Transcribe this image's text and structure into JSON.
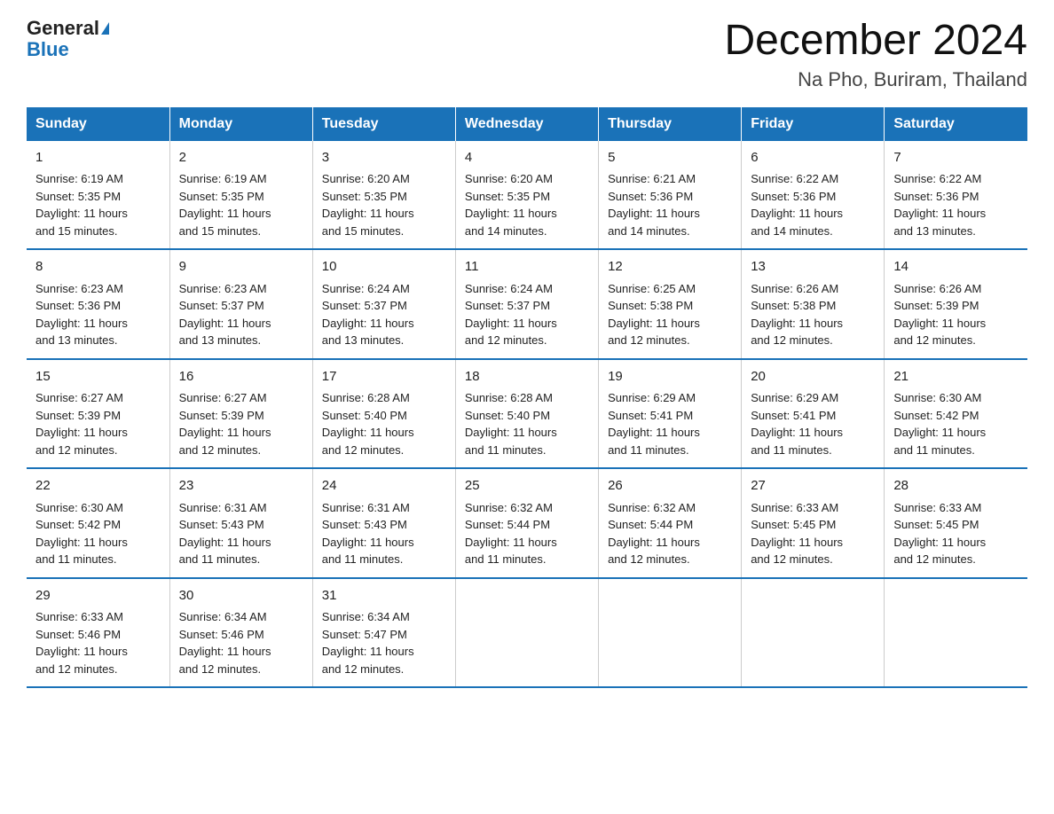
{
  "logo": {
    "text_general": "General",
    "text_blue": "Blue"
  },
  "title": "December 2024",
  "subtitle": "Na Pho, Buriram, Thailand",
  "days_of_week": [
    "Sunday",
    "Monday",
    "Tuesday",
    "Wednesday",
    "Thursday",
    "Friday",
    "Saturday"
  ],
  "weeks": [
    [
      {
        "day": "1",
        "info": "Sunrise: 6:19 AM\nSunset: 5:35 PM\nDaylight: 11 hours\nand 15 minutes."
      },
      {
        "day": "2",
        "info": "Sunrise: 6:19 AM\nSunset: 5:35 PM\nDaylight: 11 hours\nand 15 minutes."
      },
      {
        "day": "3",
        "info": "Sunrise: 6:20 AM\nSunset: 5:35 PM\nDaylight: 11 hours\nand 15 minutes."
      },
      {
        "day": "4",
        "info": "Sunrise: 6:20 AM\nSunset: 5:35 PM\nDaylight: 11 hours\nand 14 minutes."
      },
      {
        "day": "5",
        "info": "Sunrise: 6:21 AM\nSunset: 5:36 PM\nDaylight: 11 hours\nand 14 minutes."
      },
      {
        "day": "6",
        "info": "Sunrise: 6:22 AM\nSunset: 5:36 PM\nDaylight: 11 hours\nand 14 minutes."
      },
      {
        "day": "7",
        "info": "Sunrise: 6:22 AM\nSunset: 5:36 PM\nDaylight: 11 hours\nand 13 minutes."
      }
    ],
    [
      {
        "day": "8",
        "info": "Sunrise: 6:23 AM\nSunset: 5:36 PM\nDaylight: 11 hours\nand 13 minutes."
      },
      {
        "day": "9",
        "info": "Sunrise: 6:23 AM\nSunset: 5:37 PM\nDaylight: 11 hours\nand 13 minutes."
      },
      {
        "day": "10",
        "info": "Sunrise: 6:24 AM\nSunset: 5:37 PM\nDaylight: 11 hours\nand 13 minutes."
      },
      {
        "day": "11",
        "info": "Sunrise: 6:24 AM\nSunset: 5:37 PM\nDaylight: 11 hours\nand 12 minutes."
      },
      {
        "day": "12",
        "info": "Sunrise: 6:25 AM\nSunset: 5:38 PM\nDaylight: 11 hours\nand 12 minutes."
      },
      {
        "day": "13",
        "info": "Sunrise: 6:26 AM\nSunset: 5:38 PM\nDaylight: 11 hours\nand 12 minutes."
      },
      {
        "day": "14",
        "info": "Sunrise: 6:26 AM\nSunset: 5:39 PM\nDaylight: 11 hours\nand 12 minutes."
      }
    ],
    [
      {
        "day": "15",
        "info": "Sunrise: 6:27 AM\nSunset: 5:39 PM\nDaylight: 11 hours\nand 12 minutes."
      },
      {
        "day": "16",
        "info": "Sunrise: 6:27 AM\nSunset: 5:39 PM\nDaylight: 11 hours\nand 12 minutes."
      },
      {
        "day": "17",
        "info": "Sunrise: 6:28 AM\nSunset: 5:40 PM\nDaylight: 11 hours\nand 12 minutes."
      },
      {
        "day": "18",
        "info": "Sunrise: 6:28 AM\nSunset: 5:40 PM\nDaylight: 11 hours\nand 11 minutes."
      },
      {
        "day": "19",
        "info": "Sunrise: 6:29 AM\nSunset: 5:41 PM\nDaylight: 11 hours\nand 11 minutes."
      },
      {
        "day": "20",
        "info": "Sunrise: 6:29 AM\nSunset: 5:41 PM\nDaylight: 11 hours\nand 11 minutes."
      },
      {
        "day": "21",
        "info": "Sunrise: 6:30 AM\nSunset: 5:42 PM\nDaylight: 11 hours\nand 11 minutes."
      }
    ],
    [
      {
        "day": "22",
        "info": "Sunrise: 6:30 AM\nSunset: 5:42 PM\nDaylight: 11 hours\nand 11 minutes."
      },
      {
        "day": "23",
        "info": "Sunrise: 6:31 AM\nSunset: 5:43 PM\nDaylight: 11 hours\nand 11 minutes."
      },
      {
        "day": "24",
        "info": "Sunrise: 6:31 AM\nSunset: 5:43 PM\nDaylight: 11 hours\nand 11 minutes."
      },
      {
        "day": "25",
        "info": "Sunrise: 6:32 AM\nSunset: 5:44 PM\nDaylight: 11 hours\nand 11 minutes."
      },
      {
        "day": "26",
        "info": "Sunrise: 6:32 AM\nSunset: 5:44 PM\nDaylight: 11 hours\nand 12 minutes."
      },
      {
        "day": "27",
        "info": "Sunrise: 6:33 AM\nSunset: 5:45 PM\nDaylight: 11 hours\nand 12 minutes."
      },
      {
        "day": "28",
        "info": "Sunrise: 6:33 AM\nSunset: 5:45 PM\nDaylight: 11 hours\nand 12 minutes."
      }
    ],
    [
      {
        "day": "29",
        "info": "Sunrise: 6:33 AM\nSunset: 5:46 PM\nDaylight: 11 hours\nand 12 minutes."
      },
      {
        "day": "30",
        "info": "Sunrise: 6:34 AM\nSunset: 5:46 PM\nDaylight: 11 hours\nand 12 minutes."
      },
      {
        "day": "31",
        "info": "Sunrise: 6:34 AM\nSunset: 5:47 PM\nDaylight: 11 hours\nand 12 minutes."
      },
      {
        "day": "",
        "info": ""
      },
      {
        "day": "",
        "info": ""
      },
      {
        "day": "",
        "info": ""
      },
      {
        "day": "",
        "info": ""
      }
    ]
  ]
}
